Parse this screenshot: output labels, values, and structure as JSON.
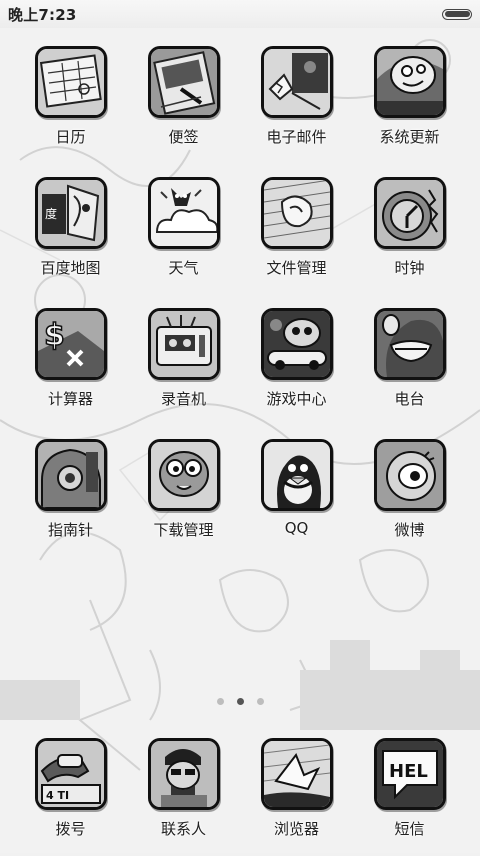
{
  "status_bar": {
    "time": "晚上7:23",
    "battery_level": 1.0
  },
  "apps": [
    {
      "label": "日历",
      "icon": "calendar-icon"
    },
    {
      "label": "便签",
      "icon": "notes-icon"
    },
    {
      "label": "电子邮件",
      "icon": "email-icon"
    },
    {
      "label": "系统更新",
      "icon": "system-update-icon"
    },
    {
      "label": "百度地图",
      "icon": "baidu-map-icon"
    },
    {
      "label": "天气",
      "icon": "weather-icon"
    },
    {
      "label": "文件管理",
      "icon": "file-manager-icon"
    },
    {
      "label": "时钟",
      "icon": "clock-icon"
    },
    {
      "label": "计算器",
      "icon": "calculator-icon"
    },
    {
      "label": "录音机",
      "icon": "recorder-icon"
    },
    {
      "label": "游戏中心",
      "icon": "game-center-icon"
    },
    {
      "label": "电台",
      "icon": "radio-icon"
    },
    {
      "label": "指南针",
      "icon": "compass-icon"
    },
    {
      "label": "下载管理",
      "icon": "download-manager-icon"
    },
    {
      "label": "QQ",
      "icon": "qq-icon"
    },
    {
      "label": "微博",
      "icon": "weibo-icon"
    }
  ],
  "page_indicator": {
    "count": 3,
    "active": 1
  },
  "dock": [
    {
      "label": "拨号",
      "icon": "phone-icon"
    },
    {
      "label": "联系人",
      "icon": "contacts-icon"
    },
    {
      "label": "浏览器",
      "icon": "browser-icon"
    },
    {
      "label": "短信",
      "icon": "messages-icon",
      "badge_text": "HEL"
    }
  ]
}
